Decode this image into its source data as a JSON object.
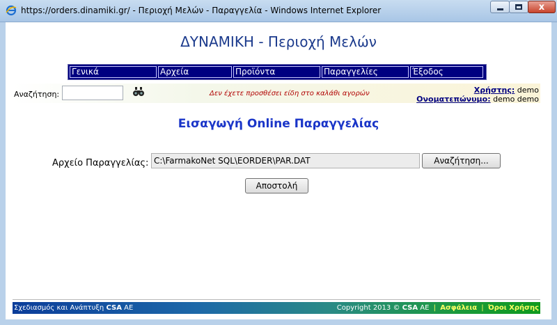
{
  "window": {
    "title": "https://orders.dinamiki.gr/ - Περιοχή Μελών - Παραγγελία - Windows Internet Explorer",
    "close_glyph": "x"
  },
  "site": {
    "title": "ΔΥΝΑΜΙΚΗ - Περιοχή Μελών"
  },
  "nav": {
    "items": [
      "Γενικά",
      "Αρχεία",
      "Προϊόντα",
      "Παραγγελίες",
      "Έξοδος"
    ]
  },
  "search": {
    "label": "Αναζήτηση:",
    "value": "",
    "cart_message": "Δεν έχετε προσθέσει είδη στο καλάθι αγορών"
  },
  "user": {
    "user_label": "Χρήστης:",
    "user_value": "demo",
    "name_label": "Ονοματεπώνυμο:",
    "name_value": "demo demo"
  },
  "form": {
    "title": "Εισαγωγή Online Παραγγελίας",
    "file_label": "Αρχείο Παραγγελίας:",
    "file_value": "C:\\FarmakoNet SQL\\EORDER\\PAR.DAT",
    "browse_label": "Αναζήτηση...",
    "submit_label": "Αποστολή"
  },
  "footer": {
    "design_text": "Σχεδιασμός και Ανάπτυξη",
    "brand": "CSA",
    "brand_suffix": "AE",
    "copyright": "Copyright 2013 ©",
    "link_security": "Ασφάλεια",
    "link_terms": "Όροι Χρήσης"
  },
  "colors": {
    "nav_background": "#000080",
    "title_blue": "#1b3a8c",
    "form_title_blue": "#1a35c8",
    "cart_message_red": "#b00000"
  },
  "icons": {
    "browser": "internet-explorer-icon",
    "search": "binoculars-icon"
  }
}
